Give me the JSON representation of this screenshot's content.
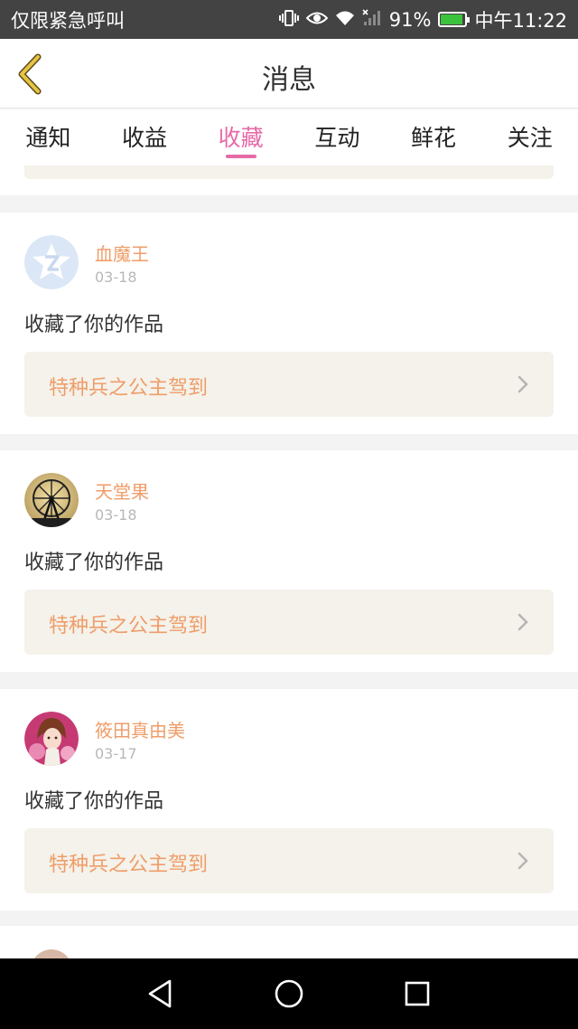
{
  "status_bar": {
    "left_text": "仅限紧急呼叫",
    "battery_percent": "91%",
    "battery_level": 0.91,
    "time": "中午11:22",
    "icons": [
      "vibrate-icon",
      "eye-icon",
      "wifi-icon",
      "signal-icon",
      "battery-icon"
    ]
  },
  "nav": {
    "title": "消息",
    "back_icon": "back-chevron-icon",
    "accent_color": "#e6c443"
  },
  "tabs": [
    {
      "label": "通知",
      "active": false
    },
    {
      "label": "收益",
      "active": false
    },
    {
      "label": "收藏",
      "active": true
    },
    {
      "label": "互动",
      "active": false
    },
    {
      "label": "鲜花",
      "active": false
    },
    {
      "label": "关注",
      "active": false
    }
  ],
  "colors": {
    "active_tab": "#e76aa7",
    "username": "#ef9d6a",
    "work_box": "#f4f2ea"
  },
  "feed": [
    {
      "username": "血魔王",
      "date": "03-18",
      "message": "收藏了你的作品",
      "work_title": "特种兵之公主驾到",
      "avatar": "qq-default-avatar"
    },
    {
      "username": "天堂果",
      "date": "03-18",
      "message": "收藏了你的作品",
      "work_title": "特种兵之公主驾到",
      "avatar": "ferris-wheel-avatar"
    },
    {
      "username": "筱田真由美",
      "date": "03-17",
      "message": "收藏了你的作品",
      "work_title": "特种兵之公主驾到",
      "avatar": "anime-girl-avatar"
    }
  ],
  "android_nav": {
    "icons": [
      "back-triangle-icon",
      "home-circle-icon",
      "recents-square-icon"
    ]
  }
}
